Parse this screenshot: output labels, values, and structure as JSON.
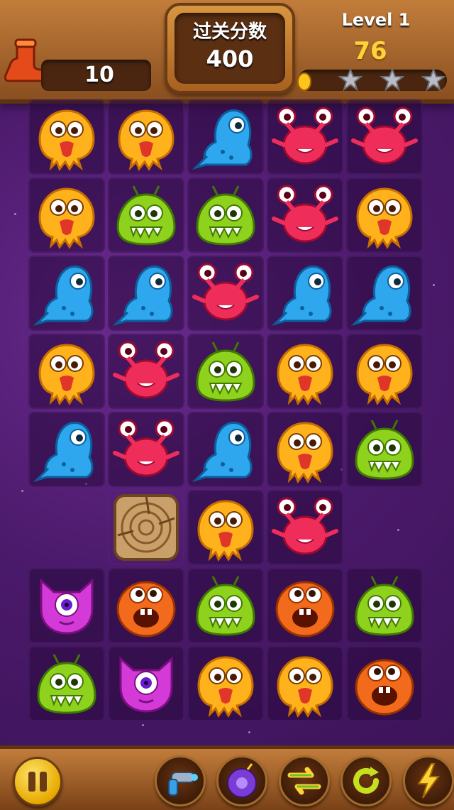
{
  "hud": {
    "moves_left": "10",
    "score_title": "过关分数",
    "score_target": "400",
    "level_label": "Level 1",
    "current_score": "76",
    "progress_fraction": 0.05,
    "stars_earned": 0,
    "stars_total": 3
  },
  "board": {
    "columns": 5,
    "rows": 8,
    "grid": [
      [
        "yellow-monster",
        "yellow-monster",
        "blue-monster",
        "red-crab",
        "red-crab"
      ],
      [
        "yellow-monster",
        "green-monster",
        "green-monster",
        "red-crab",
        "yellow-monster"
      ],
      [
        "blue-monster",
        "blue-monster",
        "red-crab",
        "blue-monster",
        "blue-monster"
      ],
      [
        "yellow-monster",
        "red-crab",
        "green-monster",
        "yellow-monster",
        "yellow-monster"
      ],
      [
        "blue-monster",
        "red-crab",
        "blue-monster",
        "yellow-monster",
        "green-monster"
      ],
      [
        "empty",
        "wood-block",
        "yellow-monster",
        "red-crab",
        "empty"
      ],
      [
        "purple-monster",
        "orange-monster",
        "green-monster",
        "orange-monster",
        "green-monster"
      ],
      [
        "green-monster",
        "purple-monster",
        "yellow-monster",
        "yellow-monster",
        "orange-monster"
      ]
    ]
  },
  "toolbar": {
    "pause_icon": "pause-icon",
    "tools": [
      "ray-gun-icon",
      "bomb-icon",
      "shuffle-icon",
      "refresh-icon",
      "lightning-icon"
    ]
  },
  "colors": {
    "wood": "#c27d3b",
    "background": "#4b1a6b",
    "accent_gold": "#ffd23a"
  }
}
